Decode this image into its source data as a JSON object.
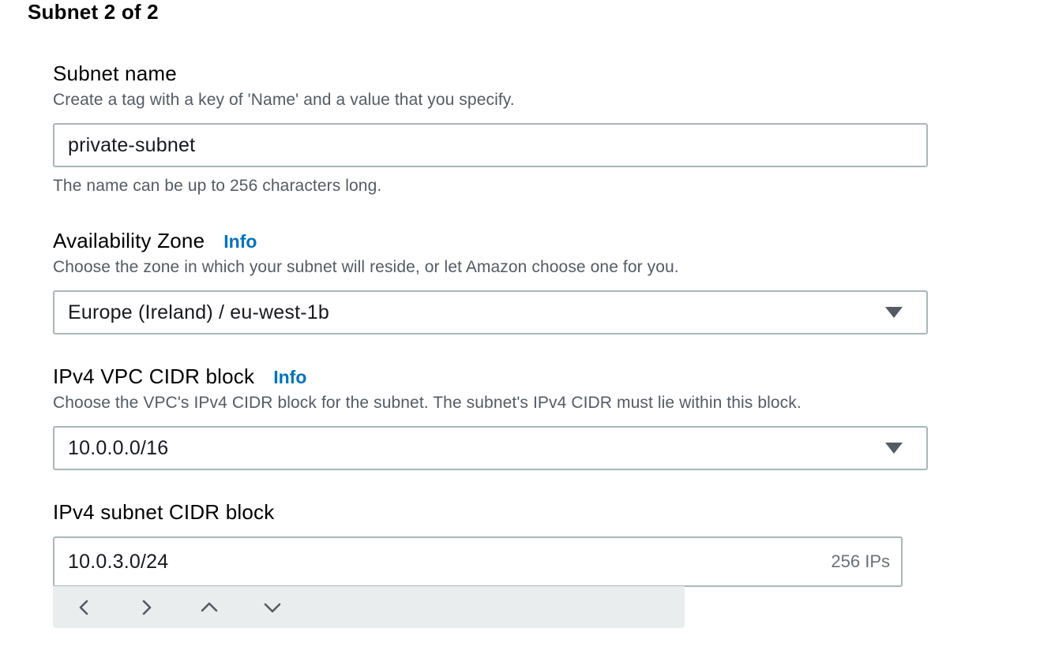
{
  "section": {
    "title": "Subnet 2 of 2"
  },
  "subnet_name": {
    "label": "Subnet name",
    "description": "Create a tag with a key of 'Name' and a value that you specify.",
    "value": "private-subnet",
    "hint": "The name can be up to 256 characters long."
  },
  "availability_zone": {
    "label": "Availability Zone",
    "info": "Info",
    "description": "Choose the zone in which your subnet will reside, or let Amazon choose one for you.",
    "selected": "Europe (Ireland) / eu-west-1b"
  },
  "vpc_cidr": {
    "label": "IPv4 VPC CIDR block",
    "info": "Info",
    "description": "Choose the VPC's IPv4 CIDR block for the subnet. The subnet's IPv4 CIDR must lie within this block.",
    "selected": "10.0.0.0/16"
  },
  "subnet_cidr": {
    "label": "IPv4 subnet CIDR block",
    "value": "10.0.3.0/24",
    "ip_count": "256 IPs",
    "stepper_icons": [
      "chevron-left-icon",
      "chevron-right-icon",
      "chevron-up-icon",
      "chevron-down-icon"
    ]
  },
  "colors": {
    "info_link": "#0073bb",
    "border": "#aab7b8",
    "secondary_text": "#545b64",
    "stepper_bg": "#eaeded"
  }
}
